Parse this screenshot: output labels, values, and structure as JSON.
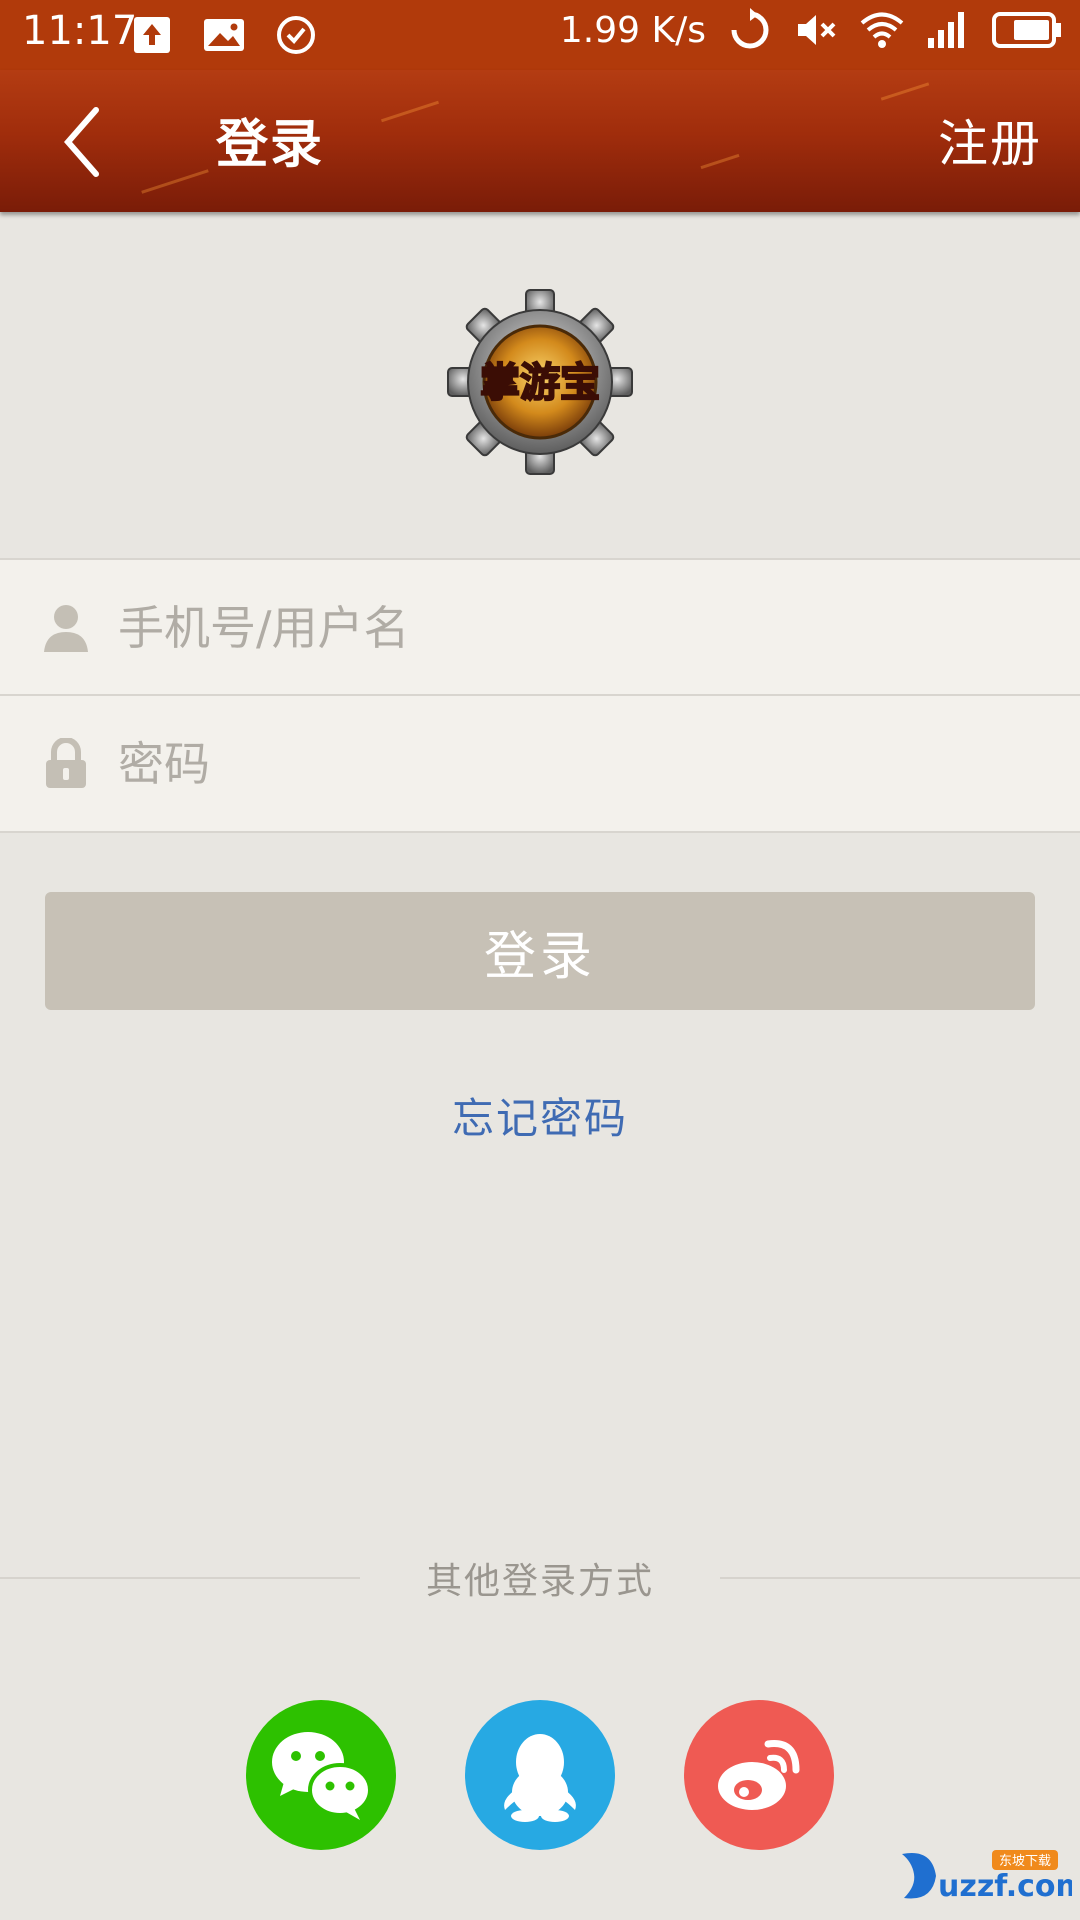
{
  "status_bar": {
    "time": "11:17",
    "speed": "1.99 K/s",
    "icons": [
      "upload-icon",
      "image-icon",
      "check-circle-icon",
      "sync-icon",
      "mute-icon",
      "wifi-icon",
      "signal-icon",
      "battery-icon"
    ]
  },
  "header": {
    "title": "登录",
    "register_label": "注册"
  },
  "logo": {
    "text": "掌游宝"
  },
  "form": {
    "username_placeholder": "手机号/用户名",
    "password_placeholder": "密码"
  },
  "login_button_label": "登录",
  "forgot_password_label": "忘记密码",
  "other_login": {
    "label": "其他登录方式",
    "providers": [
      "wechat",
      "qq",
      "weibo"
    ]
  },
  "watermark": {
    "text": "uzzf.com",
    "subtext": "东坡下载"
  },
  "colors": {
    "status_bar": "#b13a0b",
    "header": "#a02d0c",
    "background": "#e8e6e1",
    "login_button": "#c7c1b6",
    "link": "#3f6bb3",
    "wechat": "#2dc100",
    "qq": "#27a9e3",
    "weibo": "#ef5a53"
  }
}
